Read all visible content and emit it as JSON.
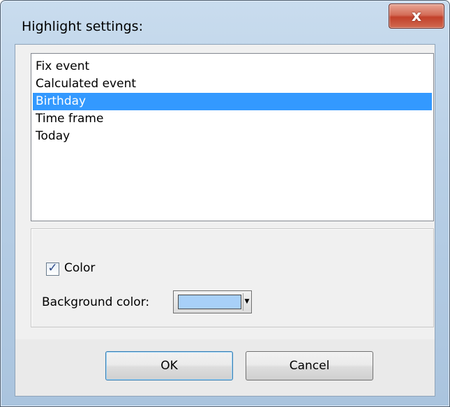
{
  "window": {
    "title": "Highlight settings:",
    "close_symbol": "x"
  },
  "list": {
    "items": [
      {
        "label": "Fix event",
        "selected": false
      },
      {
        "label": "Calculated event",
        "selected": false
      },
      {
        "label": "Birthday",
        "selected": true
      },
      {
        "label": "Time frame",
        "selected": false
      },
      {
        "label": "Today",
        "selected": false
      }
    ]
  },
  "options": {
    "color_checkbox": {
      "label": "Color",
      "checked": true
    },
    "background_color": {
      "label": "Background color:",
      "value": "#a8d0f8"
    }
  },
  "buttons": {
    "ok": "OK",
    "cancel": "Cancel"
  },
  "colors": {
    "selection": "#3399ff",
    "swatch": "#a8d0f8"
  }
}
